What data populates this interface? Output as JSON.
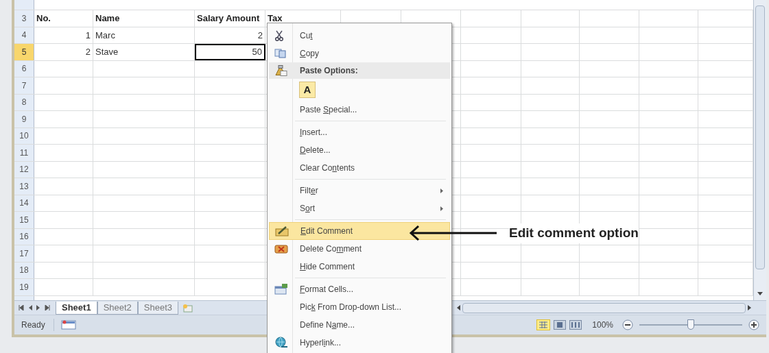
{
  "sheet": {
    "rows": [
      {
        "number": "3",
        "selected": false,
        "cells": [
          {
            "text": "No.",
            "bold": true,
            "selected": false
          },
          {
            "text": "Name",
            "bold": true,
            "selected": false
          },
          {
            "text": "Salary Amount",
            "bold": true,
            "selected": false
          },
          {
            "text": "Tax",
            "bold": true,
            "selected": false
          }
        ]
      },
      {
        "number": "4",
        "selected": false,
        "cells": [
          {
            "text": "1",
            "selected": false
          },
          {
            "text": "Marc",
            "selected": false
          },
          {
            "text": "2",
            "selected": false
          }
        ]
      },
      {
        "number": "5",
        "selected": true,
        "cells": [
          {
            "text": "2",
            "selected": false
          },
          {
            "text": "Stave",
            "selected": false
          },
          {
            "text": "50",
            "selected": true
          }
        ]
      },
      {
        "number": "6",
        "selected": false
      },
      {
        "number": "7",
        "selected": false
      },
      {
        "number": "8",
        "selected": false
      },
      {
        "number": "9",
        "selected": false
      },
      {
        "number": "10",
        "selected": false
      },
      {
        "number": "11",
        "selected": false
      },
      {
        "number": "12",
        "selected": false
      },
      {
        "number": "13",
        "selected": false
      },
      {
        "number": "14",
        "selected": false
      },
      {
        "number": "15",
        "selected": false
      },
      {
        "number": "16",
        "selected": false
      },
      {
        "number": "17",
        "selected": false
      },
      {
        "number": "18",
        "selected": false
      },
      {
        "number": "19",
        "selected": false
      }
    ]
  },
  "sheet_tabs": [
    {
      "label": "Sheet1",
      "selected": true
    },
    {
      "label": "Sheet2",
      "selected": false
    },
    {
      "label": "Sheet3",
      "selected": false
    }
  ],
  "status_bar": {
    "status": "Ready",
    "zoom": "100%",
    "zoom_slider": {
      "level": 0.5
    }
  },
  "context_menu": {
    "items": [
      {
        "kind": "item",
        "before": "Cu",
        "key": "t",
        "selected": false,
        "submenu": false
      },
      {
        "kind": "item",
        "key": "C",
        "after": "opy",
        "selected": false,
        "submenu": false
      },
      {
        "kind": "header",
        "label": "Paste Options:"
      },
      {
        "kind": "paste-option",
        "label": "A"
      },
      {
        "kind": "item",
        "before": "Paste ",
        "key": "S",
        "after": "pecial...",
        "selected": false,
        "submenu": false
      },
      {
        "kind": "separator"
      },
      {
        "kind": "item",
        "key": "I",
        "after": "nsert...",
        "selected": false,
        "submenu": false
      },
      {
        "kind": "item",
        "key": "D",
        "after": "elete...",
        "selected": false,
        "submenu": false
      },
      {
        "kind": "item",
        "before": "Clear Co",
        "key": "n",
        "after": "tents",
        "selected": false,
        "submenu": false
      },
      {
        "kind": "separator"
      },
      {
        "kind": "item",
        "before": "Filt",
        "key": "e",
        "after": "r",
        "selected": false,
        "submenu": true
      },
      {
        "kind": "item",
        "before": "S",
        "key": "o",
        "after": "rt",
        "selected": false,
        "submenu": true
      },
      {
        "kind": "separator"
      },
      {
        "kind": "item",
        "key": "E",
        "after": "dit Comment",
        "selected": true,
        "submenu": false
      },
      {
        "kind": "item",
        "before": "Delete Co",
        "key": "m",
        "after": "ment",
        "selected": false,
        "submenu": false
      },
      {
        "kind": "item",
        "key": "H",
        "after": "ide Comment",
        "selected": false,
        "submenu": false
      },
      {
        "kind": "separator"
      },
      {
        "kind": "item",
        "key": "F",
        "after": "ormat Cells...",
        "selected": false,
        "submenu": false
      },
      {
        "kind": "item",
        "before": "Pic",
        "key": "k",
        "after": " From Drop-down List...",
        "selected": false,
        "submenu": false
      },
      {
        "kind": "item",
        "before": "Define N",
        "key": "a",
        "after": "me...",
        "selected": false,
        "submenu": false
      },
      {
        "kind": "item",
        "before": "Hyperl",
        "key": "i",
        "after": "nk...",
        "selected": false,
        "submenu": false
      }
    ]
  },
  "annotation": {
    "label": "Edit comment option"
  }
}
